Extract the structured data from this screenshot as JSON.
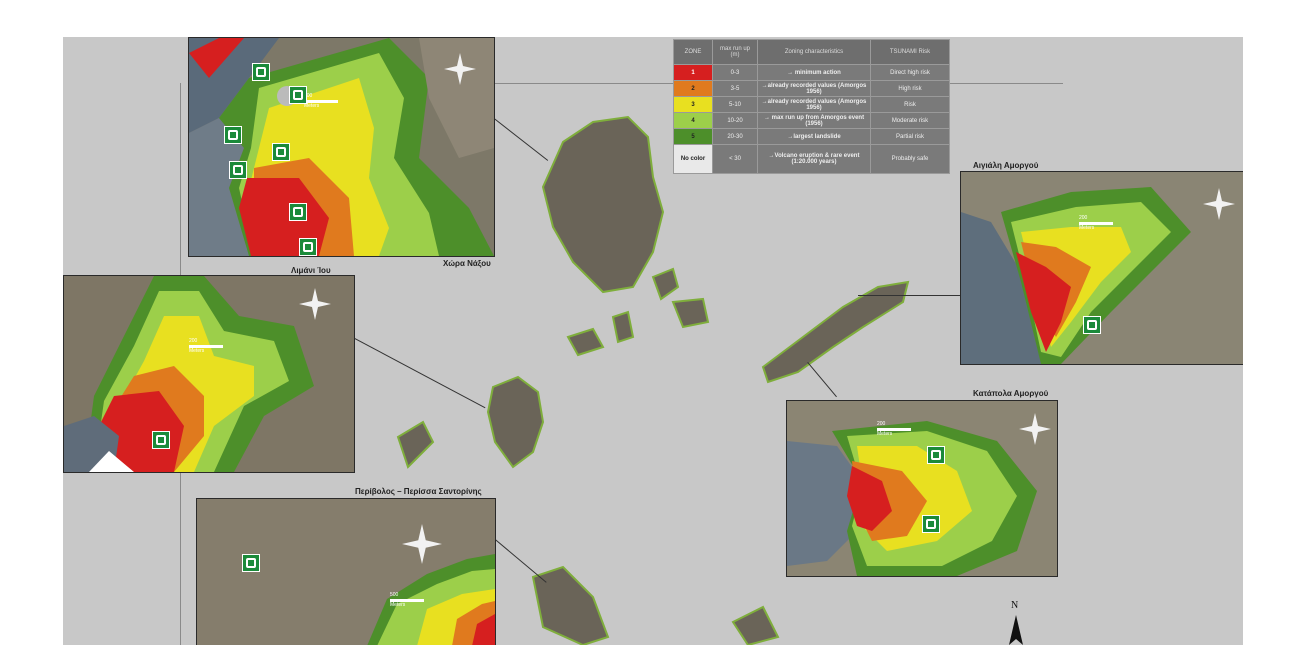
{
  "legend": {
    "headers": [
      "ZONE",
      "max run up (m)",
      "Zoning characteristics",
      "TSUNAMI Risk"
    ],
    "rows": [
      {
        "zone": "1",
        "runup": "0-3",
        "characteristics": "→ minimum action",
        "risk": "Direct high risk",
        "color": "#d61f1f"
      },
      {
        "zone": "2",
        "runup": "3-5",
        "characteristics": "→already recorded values (Amorgos 1956)",
        "risk": "High risk",
        "color": "#e07a1e"
      },
      {
        "zone": "3",
        "runup": "5-10",
        "characteristics": "→already recorded values (Amorgos 1956)",
        "risk": "Risk",
        "color": "#e8e020"
      },
      {
        "zone": "4",
        "runup": "10-20",
        "characteristics": "→ max run up from Amorgos event (1956)",
        "risk": "Moderate risk",
        "color": "#9ccf4a"
      },
      {
        "zone": "5",
        "runup": "20-30",
        "characteristics": "→largest landslide",
        "risk": "Partial risk",
        "color": "#4d8f2a"
      },
      {
        "zone": "No color",
        "runup": "< 30",
        "characteristics": "→Volcano eruption & rare event (1:20.000 years)",
        "risk": "Probably safe",
        "color": "#9a9a9a"
      }
    ]
  },
  "insets": {
    "naxos": {
      "title": "Χώρα Νάξου",
      "scale_value": "200",
      "scale_unit": "Meters"
    },
    "ios": {
      "title": "Λιμάνι Ίου",
      "scale_value": "200",
      "scale_unit": "Meters"
    },
    "aigiali": {
      "title": "Αιγιάλη Αμοργού",
      "scale_value": "200",
      "scale_unit": "Meters"
    },
    "katapola": {
      "title": "Κατάπολα Αμοργού",
      "scale_value": "200",
      "scale_unit": "Meters"
    },
    "santorini": {
      "title": "Περίβολος – Περίσσα Σαντορίνης",
      "scale_value": "500",
      "scale_unit": "Meters"
    }
  },
  "north_label": "N",
  "icons": {
    "shelter": "evacuation-shelter-icon",
    "compass": "compass-rose-icon"
  }
}
